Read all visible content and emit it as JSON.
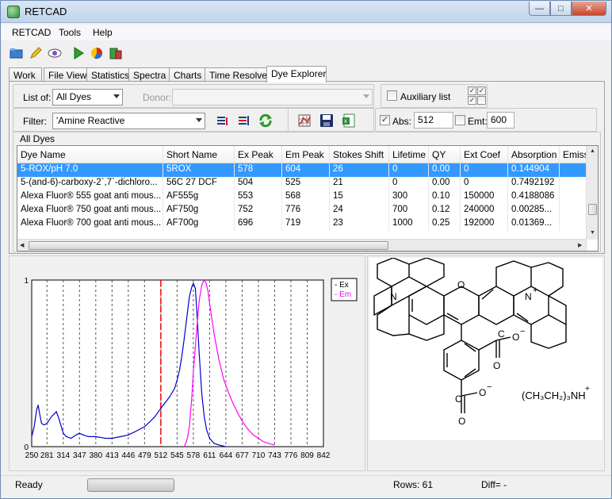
{
  "window": {
    "title": "RETCAD"
  },
  "menu": {
    "items": [
      "RETCAD",
      "Tools",
      "Help"
    ]
  },
  "tabs": [
    "Work",
    "File View",
    "Statistics",
    "Spectra",
    "Charts",
    "Time Resolved",
    "Dye Explorer"
  ],
  "active_tab": "Dye Explorer",
  "dye_explorer": {
    "list_of_label": "List of:",
    "list_of_value": "All Dyes",
    "donor_label": "Donor:",
    "donor_value": "",
    "auxiliary_label": "Auxiliary list",
    "filter_label": "Filter:",
    "filter_value": "'Amine Reactive",
    "abs_label": "Abs:",
    "abs_value": "512",
    "emt_label": "Emt:",
    "emt_value": "600",
    "abs_checked": true,
    "emt_checked": false,
    "aux_checked": false
  },
  "grid": {
    "title": "All Dyes",
    "columns": [
      "Dye Name",
      "Short Name",
      "Ex Peak",
      "Em Peak",
      "Stokes Shift",
      "Lifetime",
      "QY",
      "Ext Coef",
      "Absorption",
      "Emissi"
    ],
    "rows": [
      [
        "5-ROX/pH 7.0",
        "5ROX",
        "578",
        "604",
        "26",
        "0",
        "0.00",
        "0",
        "0.144904",
        ""
      ],
      [
        "5-(and-6)-carboxy-2`,7`-dichloro...",
        "56C 27 DCF",
        "504",
        "525",
        "21",
        "0",
        "0.00",
        "0",
        "0.7492192",
        ""
      ],
      [
        "Alexa Fluor® 555 goat anti mous...",
        "AF555g",
        "553",
        "568",
        "15",
        "300",
        "0.10",
        "150000",
        "0.4188086",
        ""
      ],
      [
        "Alexa Fluor® 750 goat anti mous...",
        "AF750g",
        "752",
        "776",
        "24",
        "700",
        "0.12",
        "240000",
        "0.00285...",
        ""
      ],
      [
        "Alexa Fluor® 700 goat anti mous...",
        "AF700g",
        "696",
        "719",
        "23",
        "1000",
        "0.25",
        "192000",
        "0.01369...",
        ""
      ]
    ],
    "selected_row": 0
  },
  "chart_data": {
    "type": "line",
    "x_ticks": [
      "250",
      "281",
      "314",
      "347",
      "380",
      "413",
      "446",
      "479",
      "512",
      "545",
      "578",
      "611",
      "644",
      "677",
      "710",
      "743",
      "776",
      "809",
      "842"
    ],
    "y_ticks": [
      "0",
      "1"
    ],
    "xlim": [
      250,
      842
    ],
    "ylim": [
      0,
      1
    ],
    "legend": [
      "Ex",
      "Em"
    ],
    "legend_position": "top-right",
    "marker_x": 512,
    "colors": {
      "ex": "#0000cc",
      "em": "#ff00ff",
      "marker": "#ff0000"
    },
    "series": [
      {
        "name": "Ex",
        "x": [
          250,
          255,
          260,
          263,
          266,
          270,
          275,
          281,
          290,
          300,
          305,
          310,
          314,
          320,
          330,
          340,
          347,
          355,
          365,
          380,
          400,
          413,
          430,
          446,
          460,
          479,
          490,
          500,
          512,
          520,
          530,
          540,
          545,
          550,
          555,
          560,
          565,
          570,
          575,
          578,
          582,
          585,
          590,
          595,
          600,
          605,
          611,
          620,
          630,
          644
        ],
        "y": [
          0.06,
          0.12,
          0.22,
          0.25,
          0.2,
          0.14,
          0.13,
          0.14,
          0.18,
          0.21,
          0.17,
          0.12,
          0.08,
          0.06,
          0.05,
          0.07,
          0.08,
          0.07,
          0.06,
          0.06,
          0.05,
          0.05,
          0.06,
          0.07,
          0.09,
          0.12,
          0.15,
          0.18,
          0.23,
          0.26,
          0.3,
          0.35,
          0.4,
          0.46,
          0.55,
          0.66,
          0.78,
          0.9,
          0.96,
          0.98,
          0.95,
          0.82,
          0.55,
          0.32,
          0.18,
          0.1,
          0.05,
          0.02,
          0.01,
          0.0
        ]
      },
      {
        "name": "Em",
        "x": [
          560,
          566,
          570,
          575,
          578,
          582,
          586,
          590,
          595,
          600,
          604,
          608,
          611,
          615,
          620,
          625,
          630,
          640,
          650,
          660,
          670,
          680,
          690,
          700,
          710,
          720,
          730,
          743
        ],
        "y": [
          0.0,
          0.05,
          0.12,
          0.3,
          0.45,
          0.6,
          0.75,
          0.88,
          0.97,
          1.0,
          0.98,
          0.93,
          0.86,
          0.78,
          0.68,
          0.6,
          0.52,
          0.4,
          0.32,
          0.25,
          0.19,
          0.14,
          0.1,
          0.07,
          0.05,
          0.03,
          0.02,
          0.01
        ]
      }
    ]
  },
  "structure": {
    "atoms": [
      "N",
      "O",
      "N",
      "+"
    ],
    "carboxylate_labels": [
      "C",
      "O",
      "O",
      "−",
      "C",
      "O",
      "O",
      "−"
    ],
    "counterion": "(CH₃CH₂)₃NH",
    "counterion_plus": "+"
  },
  "status": {
    "ready": "Ready",
    "rows": "Rows:  61",
    "diff": "Diff= -"
  }
}
